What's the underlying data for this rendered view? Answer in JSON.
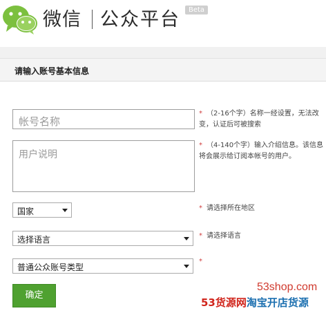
{
  "header": {
    "brand": "微信",
    "sub": "公众平台",
    "badge": "Beta"
  },
  "section": {
    "title": "请输入账号基本信息"
  },
  "form": {
    "account_name_placeholder": "帐号名称",
    "description_placeholder": "用户说明",
    "region_selected": "国家",
    "language_selected": "选择语言",
    "account_type_selected": "普通公众账号类型",
    "submit_label": "确定"
  },
  "hints": {
    "star": "*",
    "name_hint": "（2-16个字）名称一经设置，无法改变，认证后可被搜索",
    "description_hint": "（4-140个字）输入介绍信息。该信息将会展示给订阅本帐号的用户。",
    "region_hint": "请选择所在地区",
    "language_hint": "请选择语言",
    "type_hint": ""
  },
  "watermark": {
    "url": "53shop.com",
    "red_text": "53货源网",
    "blue_text": "淘宝开店货源"
  },
  "colors": {
    "brand_green": "#4fa130",
    "required_red": "#d04040"
  },
  "icons": {
    "logo": "wechat-logo-icon"
  }
}
